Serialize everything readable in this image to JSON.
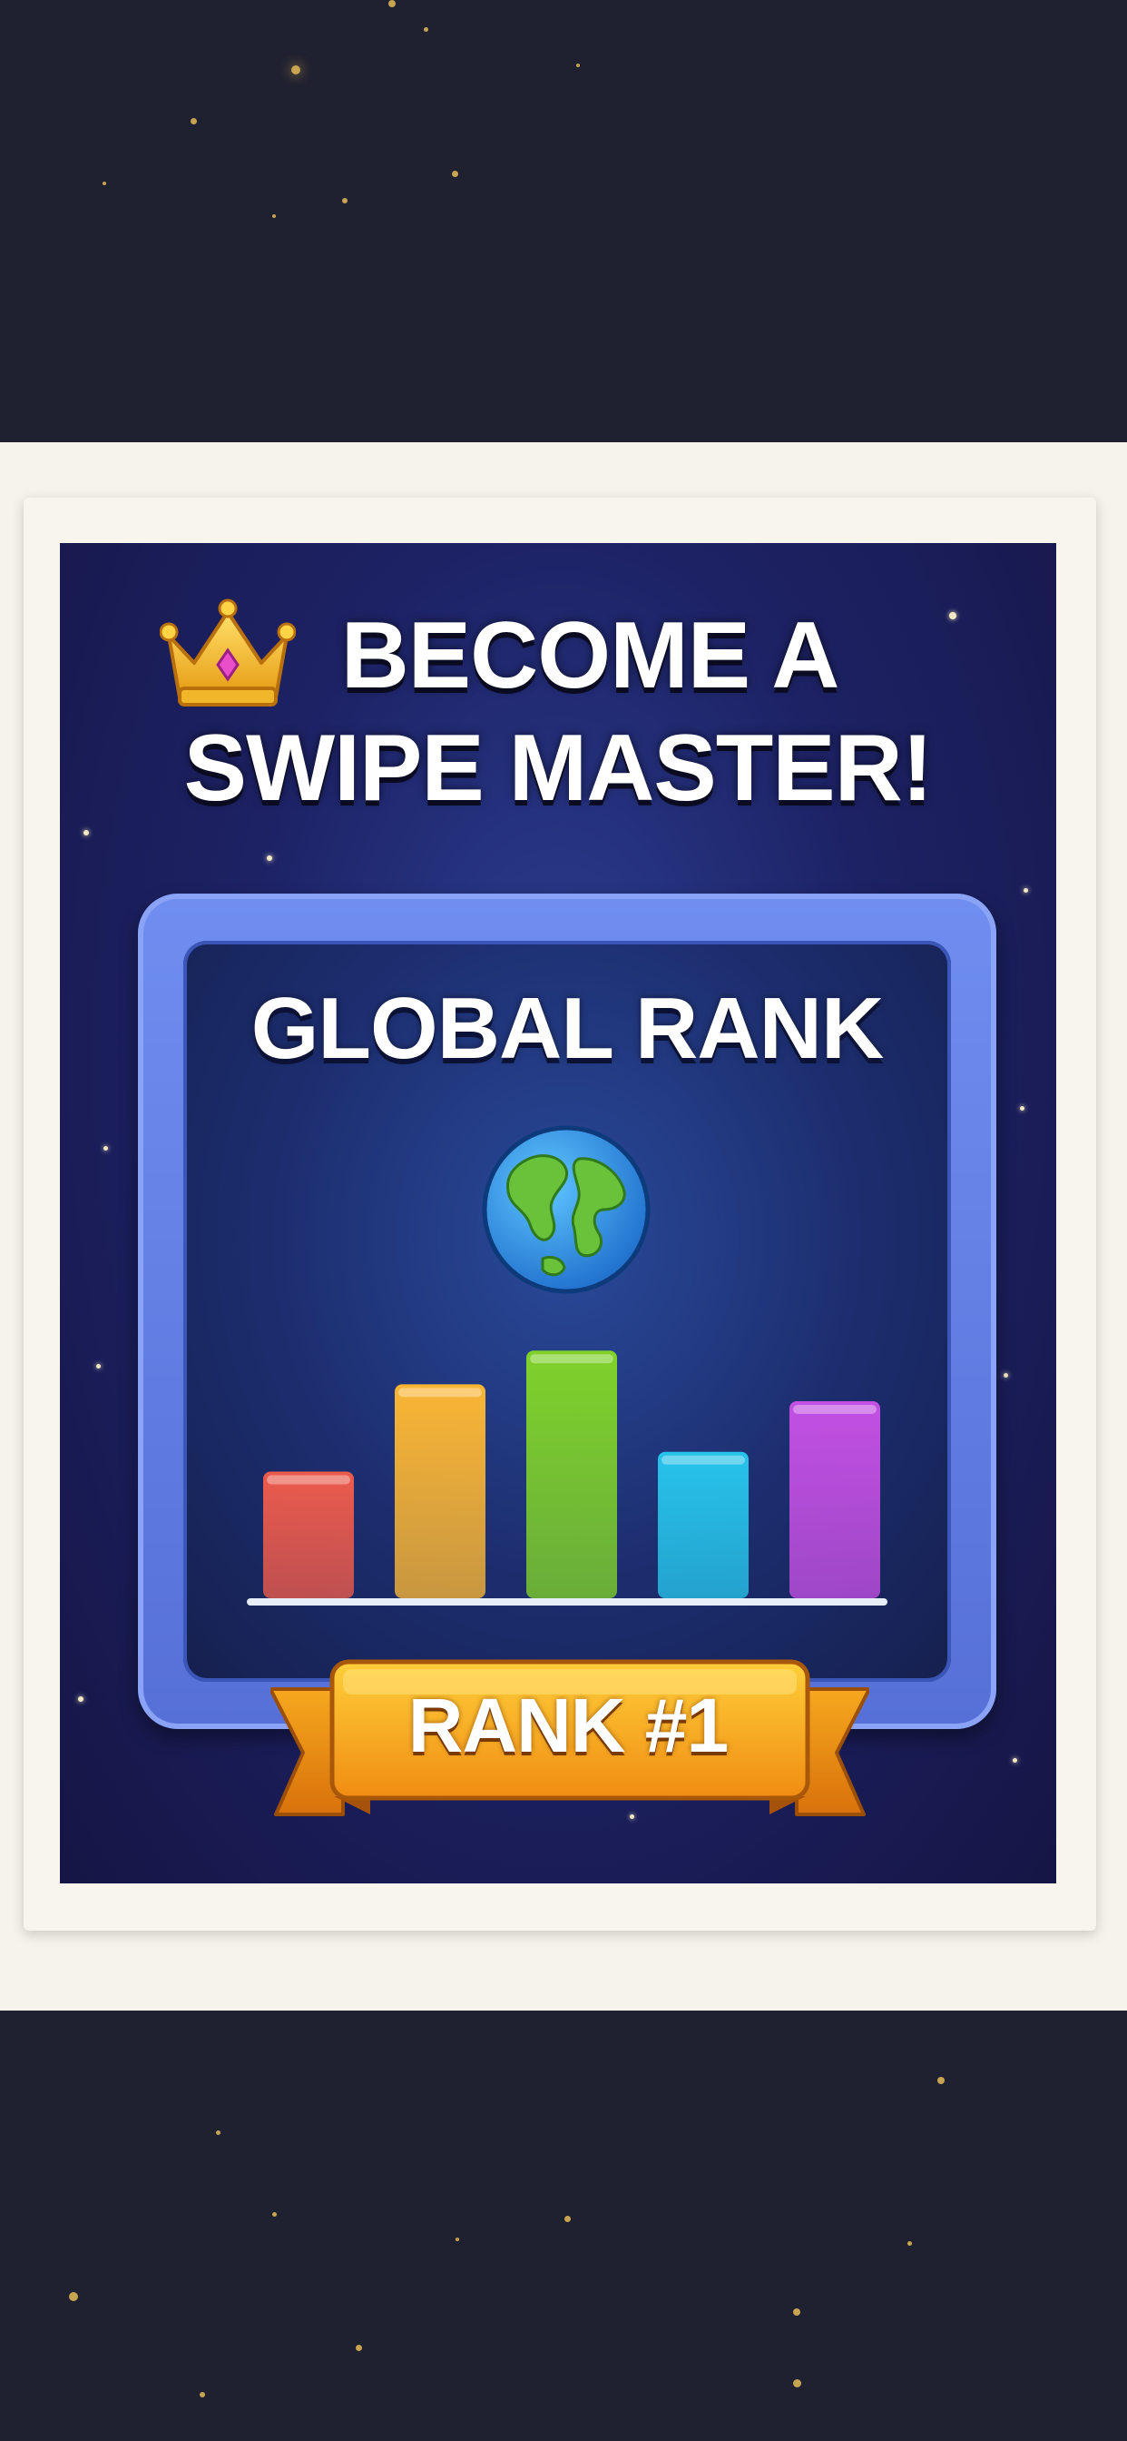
{
  "poster": {
    "headline_line1": "BECOME A",
    "headline_line2": "SWIPE MASTER!",
    "rank_title": "GLOBAL RANK",
    "rank_label": "RANK #1"
  },
  "colors": {
    "background": "#1f2030",
    "cream": "#f6f3ea",
    "poster_navy": "#1d2265",
    "frame_blue": "#6f8ef0",
    "ribbon_orange": "#f7a81e"
  },
  "icons": [
    "crown-icon",
    "globe-icon"
  ],
  "chart_data": {
    "type": "bar",
    "categories": [
      "",
      "",
      "",
      "",
      ""
    ],
    "values": [
      45,
      76,
      88,
      52,
      70
    ],
    "colors": [
      "#ec5b4c",
      "#f9b534",
      "#7fd12a",
      "#26c3ea",
      "#c350e3"
    ],
    "ylim": [
      0,
      100
    ],
    "title": "",
    "xlabel": "",
    "ylabel": ""
  }
}
